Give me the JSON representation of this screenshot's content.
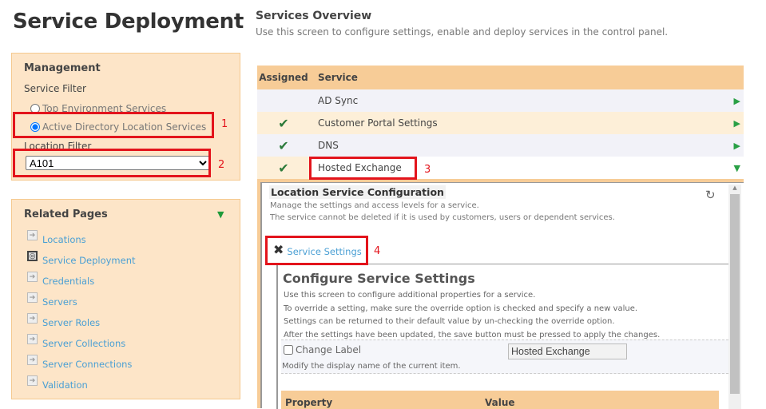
{
  "page_title": "Service Deployment",
  "management": {
    "heading": "Management",
    "service_filter_label": "Service Filter",
    "radio_options": [
      {
        "label": "Top Environment Services",
        "selected": false
      },
      {
        "label": "Active Directory Location Services",
        "selected": true
      }
    ],
    "location_filter_label": "Location Filter",
    "location_value": "A101"
  },
  "related_pages": {
    "heading": "Related Pages",
    "items": [
      {
        "label": "Locations"
      },
      {
        "label": "Service Deployment",
        "current": true
      },
      {
        "label": "Credentials"
      },
      {
        "label": "Servers"
      },
      {
        "label": "Server Roles"
      },
      {
        "label": "Server Collections"
      },
      {
        "label": "Server Connections"
      },
      {
        "label": "Validation"
      }
    ]
  },
  "overview": {
    "heading": "Services Overview",
    "subtitle": "Use this screen to configure settings, enable and deploy services in the control panel.",
    "columns": [
      "Assigned",
      "Service"
    ],
    "rows": [
      {
        "assigned": false,
        "service": "AD Sync"
      },
      {
        "assigned": true,
        "service": "Customer Portal Settings"
      },
      {
        "assigned": true,
        "service": "DNS"
      },
      {
        "assigned": true,
        "service": "Hosted Exchange",
        "expanded": true
      }
    ]
  },
  "config": {
    "heading": "Location Service Configuration",
    "desc1": "Manage the settings and access levels for a service.",
    "desc2": "The service cannot be deleted if it is used by customers, users or dependent services.",
    "tab_label": "Service Settings",
    "section_heading": "Configure Service Settings",
    "lines": [
      "Use this screen to configure additional properties for a service.",
      "To override a setting, make sure the override option is checked and specify a new value.",
      "Settings can be returned to their default value by un-checking the override option.",
      "After the settings have been updated, the save button must be pressed to apply the changes."
    ],
    "change_label": "Change Label",
    "change_label_value": "Hosted Exchange",
    "change_label_help": "Modify the display name of the current item.",
    "prop_columns": [
      "Property",
      "Value"
    ]
  },
  "annotations": [
    "1",
    "2",
    "3",
    "4"
  ],
  "colors": {
    "panel": "#fde5c8",
    "header": "#f7cc97",
    "accent_red": "#e3141c",
    "link": "#4a9fd4",
    "check": "#2b7a3a"
  }
}
